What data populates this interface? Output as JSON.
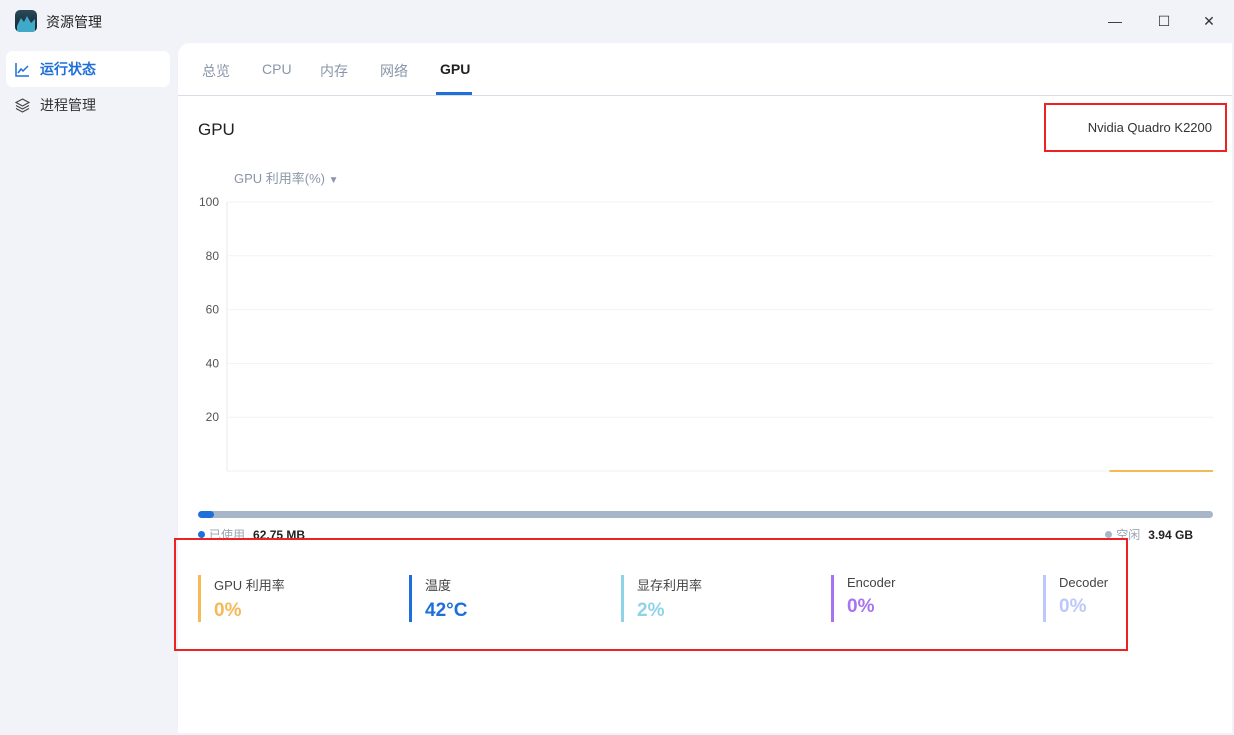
{
  "window": {
    "title": "资源管理",
    "minimize": "—",
    "maximize": "☐",
    "close": "✕"
  },
  "sidebar": {
    "items": [
      {
        "label": "运行状态",
        "icon": "chart-line-icon",
        "active": true
      },
      {
        "label": "进程管理",
        "icon": "layers-icon",
        "active": false
      }
    ]
  },
  "tabs": [
    {
      "label": "总览"
    },
    {
      "label": "CPU"
    },
    {
      "label": "内存"
    },
    {
      "label": "网络"
    },
    {
      "label": "GPU",
      "active": true
    }
  ],
  "section": {
    "title": "GPU",
    "device": "Nvidia Quadro K2200"
  },
  "chart_data": {
    "type": "line",
    "title": "GPU 利用率(%)",
    "ylim": [
      0,
      100
    ],
    "yticks": [
      20,
      40,
      60,
      80,
      100
    ],
    "series": [
      {
        "name": "GPU 利用率",
        "color": "#f5b955",
        "values": [
          0,
          0,
          0,
          0,
          0,
          0
        ]
      }
    ],
    "visible_fraction_start": 0.895
  },
  "memory": {
    "used_label": "已使用",
    "used_value": "62.75 MB",
    "free_label": "空闲",
    "free_value": "3.94 GB",
    "used_fraction": 0.0156,
    "used_color": "#1e6fd9",
    "free_color": "#a7b7c9"
  },
  "stats": [
    {
      "label": "GPU 利用率",
      "value": "0%",
      "color": "#f5b955"
    },
    {
      "label": "温度",
      "value": "42°C",
      "color": "#1e6fd9"
    },
    {
      "label": "显存利用率",
      "value": "2%",
      "color": "#8fd3e8"
    },
    {
      "label": "Encoder",
      "value": "0%",
      "color": "#a873f0"
    },
    {
      "label": "Decoder",
      "value": "0%",
      "color": "#bcc8fb"
    }
  ]
}
